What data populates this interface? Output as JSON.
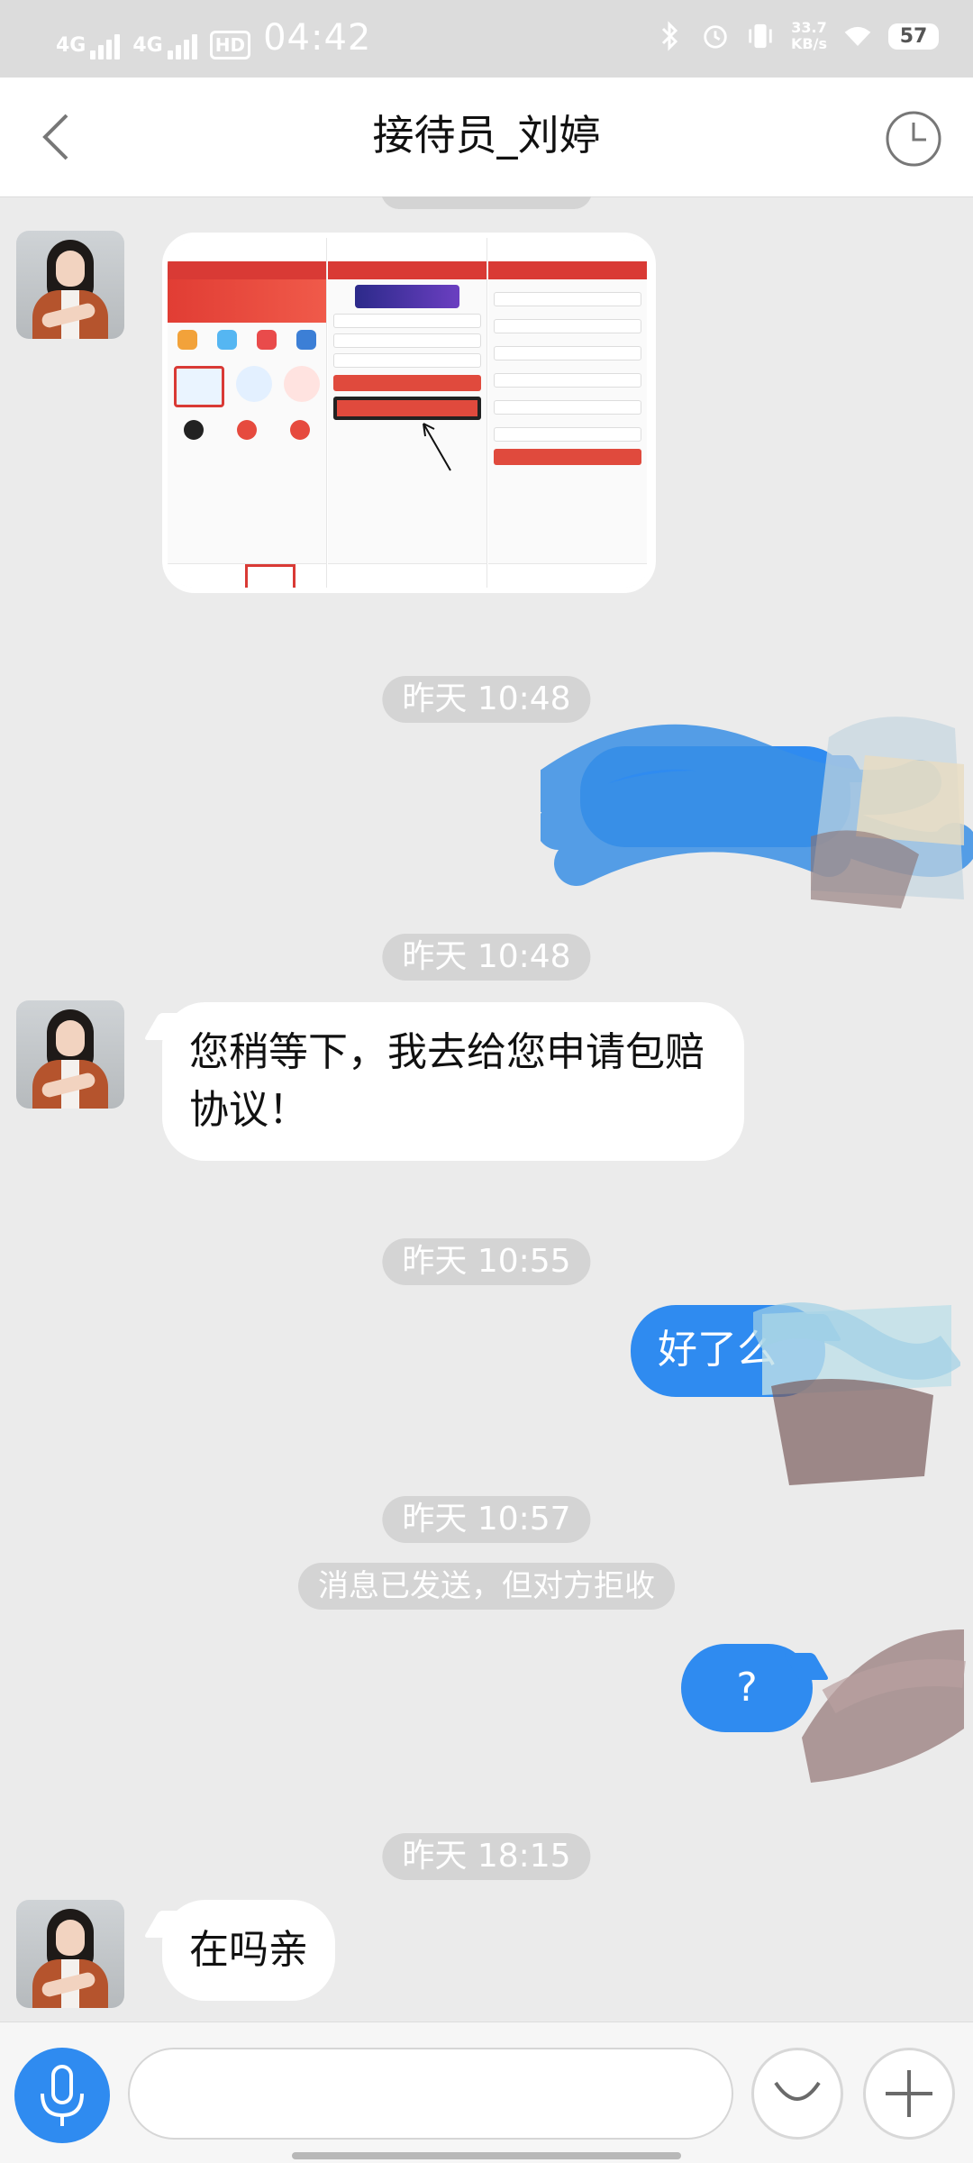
{
  "status_bar": {
    "sim1": "4G",
    "sim2": "4G",
    "hd": "HD",
    "time": "04:42",
    "net_speed_value": "33.7",
    "net_speed_unit": "KB/s",
    "battery": "57"
  },
  "header": {
    "title": "接待员_刘婷"
  },
  "messages": {
    "ts1": "昨天 10:48",
    "ts2": "昨天 10:48",
    "msg2": "您稍等下，我去给您申请包赔协议！",
    "ts3": "昨天 10:55",
    "msg3": "好了么",
    "ts4": "昨天 10:57",
    "notice": "消息已发送，但对方拒收",
    "msg4": "?",
    "ts5": "昨天 18:15",
    "msg5": "在吗亲"
  },
  "input": {
    "placeholder": ""
  },
  "colors": {
    "accent": "#2f8bf0",
    "background": "#ebebeb",
    "header": "#ffffff"
  },
  "icons": {
    "back": "chevron-left-icon",
    "history": "clock-icon",
    "voice": "microphone-icon",
    "emoji": "smiley-icon",
    "more": "plus-icon"
  }
}
